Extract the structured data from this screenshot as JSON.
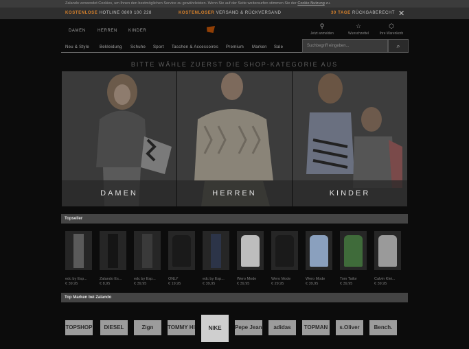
{
  "cookie_banner": {
    "text": "Zalando verwendet Cookies, um Ihnen den bestmöglichen Service zu gewährleisten. Wenn Sie auf der Seite weitersurfen stimmen Sie der",
    "link": "Cookie-Nutzung",
    "suffix": "zu."
  },
  "usp_bar": {
    "hotline_strong": "KOSTENLOSE",
    "hotline_text": "HOTLINE 0800 100 228",
    "shipping_strong": "KOSTENLOSER",
    "shipping_text": "VERSAND & RÜCKVERSAND",
    "return_strong": "30 TAGE",
    "return_text": "RÜCKGABERECHT",
    "close_icon": "close-icon",
    "accent_color": "#d9822b"
  },
  "header": {
    "gender_tabs": [
      "DAMEN",
      "HERREN",
      "KINDER"
    ],
    "logo_icon": "zalando-play-icon",
    "account": [
      {
        "icon": "user-icon",
        "label": "Jetzt anmelden"
      },
      {
        "icon": "star-icon",
        "label": "Wunschzettel"
      },
      {
        "icon": "bag-icon",
        "label": "Ihre Warenkorb"
      }
    ]
  },
  "category_nav": [
    "Neu & Style",
    "Bekleidung",
    "Schuhe",
    "Sport",
    "Taschen & Accessoires",
    "Premium",
    "Marken",
    "Sale"
  ],
  "search": {
    "placeholder": "Suchbegriff eingeben...",
    "icon": "search-icon"
  },
  "shop_heading": "BITTE WÄHLE ZUERST DIE SHOP-KATEGORIE AUS",
  "shop_tiles": [
    {
      "label": "DAMEN"
    },
    {
      "label": "HERREN"
    },
    {
      "label": "KINDER"
    }
  ],
  "topseller": {
    "title": "Topseller",
    "products": [
      {
        "name": "edc by Esp...",
        "price": "€ 39,95"
      },
      {
        "name": "Zalando Es...",
        "price": "€ 8,95"
      },
      {
        "name": "edc by Esp...",
        "price": "€ 39,95"
      },
      {
        "name": "ONLY",
        "price": "€ 19,95"
      },
      {
        "name": "edc by Esp...",
        "price": "€ 39,95"
      },
      {
        "name": "Wero Mode",
        "price": "€ 39,95"
      },
      {
        "name": "Wero Mode",
        "price": "€ 29,95"
      },
      {
        "name": "Wero Mode",
        "price": "€ 39,95"
      },
      {
        "name": "Tom Tailor",
        "price": "€ 39,95"
      },
      {
        "name": "Calvin Klei...",
        "price": "€ 39,95"
      }
    ]
  },
  "brands": {
    "title": "Top Marken bei Zalando",
    "items": [
      "TOPSHOP",
      "DIESEL",
      "Zign",
      "TOMMY HILFIGER",
      "NIKE",
      "Pepe Jeans",
      "adidas",
      "TOPMAN",
      "s.Oliver",
      "Bench."
    ]
  }
}
